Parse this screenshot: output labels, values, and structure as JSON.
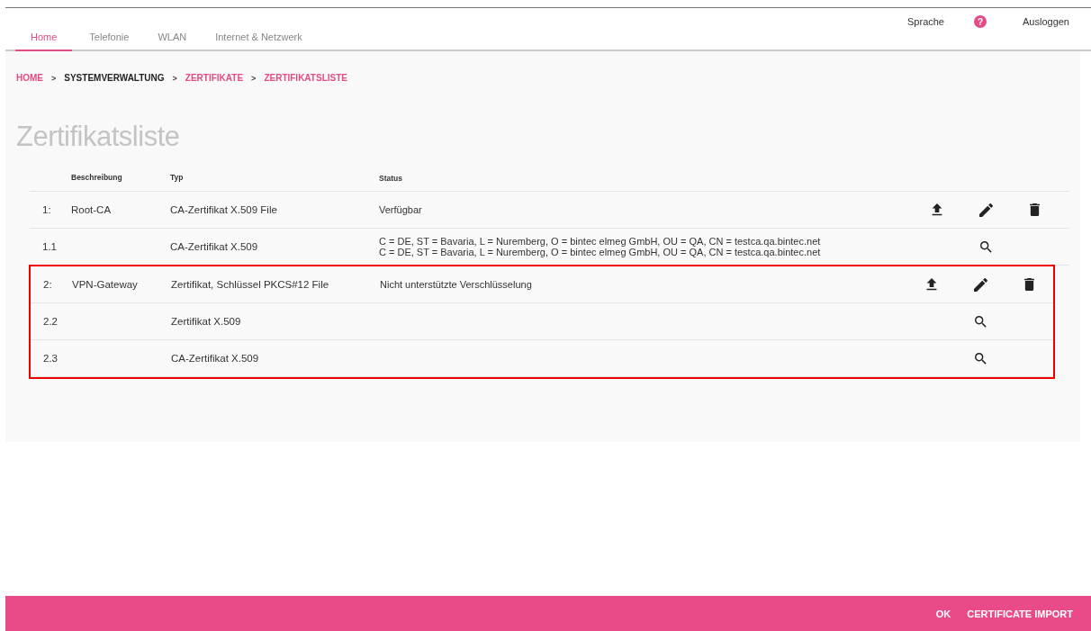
{
  "header": {
    "tabs": [
      {
        "label": "Home",
        "selected": true
      },
      {
        "label": "Telefonie",
        "selected": false
      },
      {
        "label": "WLAN",
        "selected": false
      },
      {
        "label": "Internet & Netzwerk",
        "selected": false
      }
    ],
    "links": [
      {
        "label": "Sprache",
        "kind": "text"
      },
      {
        "label": "?",
        "kind": "help"
      },
      {
        "label": "Ausloggen",
        "kind": "text"
      }
    ]
  },
  "breadcrumb": [
    {
      "label": "HOME",
      "link": true
    },
    {
      "label": "SYSTEMVERWALTUNG",
      "link": false
    },
    {
      "label": "ZERTIFIKATE",
      "link": true
    },
    {
      "label": "ZERTIFIKATSLISTE",
      "link": true
    }
  ],
  "breadcrumb_separator": ">",
  "page_title": "Zertifikatsliste",
  "table": {
    "columns": [
      "Beschreibung",
      "Typ",
      "Status"
    ],
    "groups": [
      {
        "highlighted": false,
        "rows": [
          {
            "number": "1:",
            "description": "Root-CA",
            "type": "CA-Zertifikat X.509 File",
            "status": [
              "Verfügbar"
            ],
            "actions": [
              {
                "kind": "upload"
              },
              {
                "kind": "edit"
              },
              {
                "kind": "delete"
              }
            ]
          },
          {
            "number": "1.1",
            "description": "",
            "type": "CA-Zertifikat X.509",
            "status": [
              "C = DE, ST = Bavaria, L = Nuremberg, O = bintec elmeg GmbH, OU = QA, CN = testca.qa.bintec.net",
              "C = DE, ST = Bavaria, L = Nuremberg, O = bintec elmeg GmbH, OU = QA, CN = testca.qa.bintec.net"
            ],
            "actions": [
              {
                "kind": "view"
              }
            ]
          }
        ]
      },
      {
        "highlighted": true,
        "rows": [
          {
            "number": "2:",
            "description": "VPN-Gateway",
            "type": "Zertifikat, Schlüssel PKCS#12 File",
            "status": [
              "Nicht unterstützte Verschlüsselung"
            ],
            "actions": [
              {
                "kind": "upload"
              },
              {
                "kind": "edit"
              },
              {
                "kind": "delete"
              }
            ]
          },
          {
            "number": "2.2",
            "description": "",
            "type": "Zertifikat X.509",
            "status": [],
            "actions": [
              {
                "kind": "view"
              }
            ]
          },
          {
            "number": "2.3",
            "description": "",
            "type": "CA-Zertifikat X.509",
            "status": [],
            "actions": [
              {
                "kind": "view"
              }
            ]
          }
        ]
      }
    ]
  },
  "footer_buttons": [
    "OK",
    "CERTIFICATE IMPORT"
  ]
}
